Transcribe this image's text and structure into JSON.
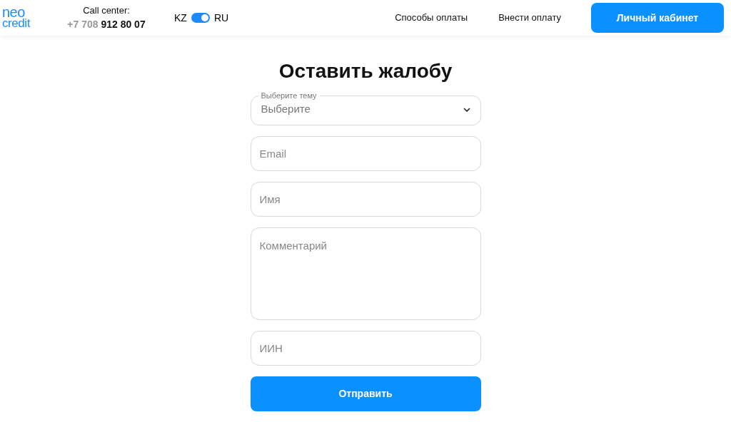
{
  "header": {
    "logo": [
      "neo",
      "credit"
    ],
    "call_center": {
      "label": "Call center:",
      "phone_prefix": "+7 708",
      "phone_number": "912 80 07"
    },
    "language": {
      "left": "KZ",
      "right": "RU",
      "on": true
    },
    "nav": [
      "Способы оплаты",
      "Внести оплату"
    ],
    "account_button": "Личный кабинет"
  },
  "form": {
    "title": "Оставить жалобу",
    "fields": [
      {
        "kind": "select",
        "label": "Выберите тему",
        "value": "Выберите"
      },
      {
        "kind": "input",
        "placeholder": "Email"
      },
      {
        "kind": "input",
        "placeholder": "Имя"
      },
      {
        "kind": "textarea",
        "placeholder": "Комментарий"
      },
      {
        "kind": "input",
        "placeholder": "ИИН"
      }
    ],
    "submit": "Отправить"
  }
}
